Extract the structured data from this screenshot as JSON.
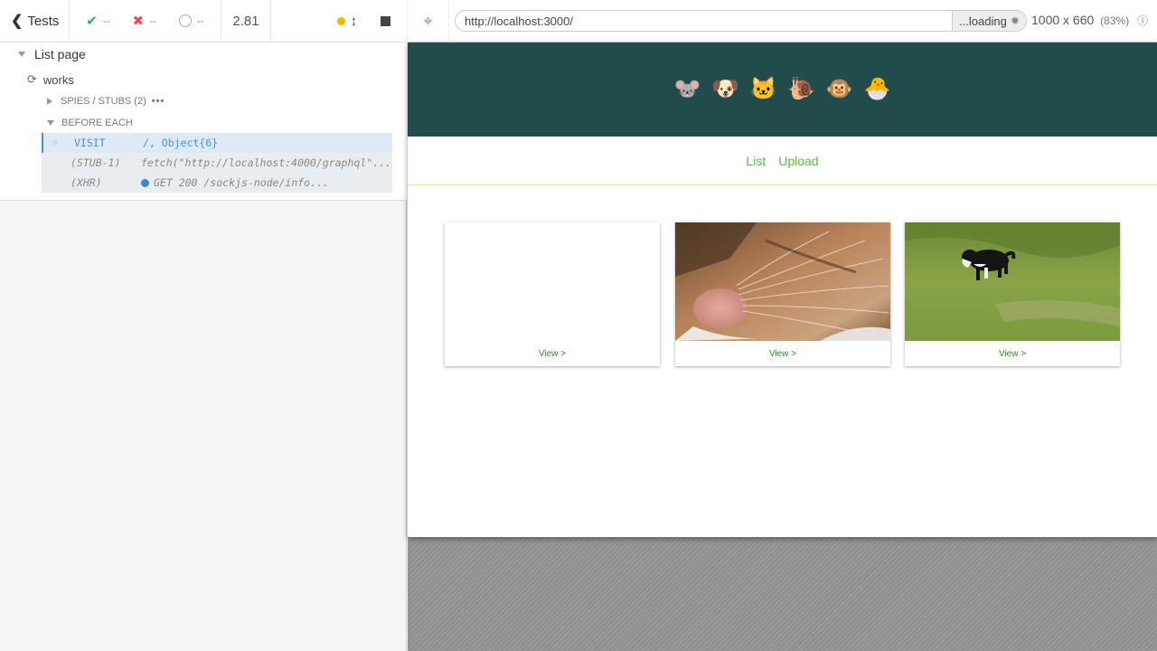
{
  "reporter": {
    "tests_label": "Tests",
    "passed": "--",
    "failed": "--",
    "pending": "--",
    "duration": "2.81",
    "suite_title": "List page",
    "test_title": "works",
    "spies_label": "SPIES / STUBS (2)",
    "hook_label": "BEFORE EACH",
    "commands": [
      {
        "name": "VISIT",
        "message": "/, Object{6}"
      },
      {
        "name": "(STUB-1)",
        "message": "fetch(\"http://localhost:4000/graphql\"..."
      },
      {
        "name": "(XHR)",
        "message": "GET 200 /sockjs-node/info..."
      }
    ]
  },
  "browser": {
    "url": "http://localhost:3000/",
    "loading_label": "...loading",
    "viewport_size": "1000 x 660",
    "viewport_scale": "(83%)"
  },
  "app": {
    "banner_color": "#214c4b",
    "animals": [
      "🐭",
      "🐶",
      "🐱",
      "🐌",
      "🐵",
      "🐣"
    ],
    "nav": {
      "list_label": "List",
      "upload_label": "Upload"
    },
    "cards": [
      {
        "image": "blank",
        "link_label": "View >"
      },
      {
        "image": "cat-closeup",
        "link_label": "View >"
      },
      {
        "image": "dog-on-grass",
        "link_label": "View >"
      }
    ]
  }
}
